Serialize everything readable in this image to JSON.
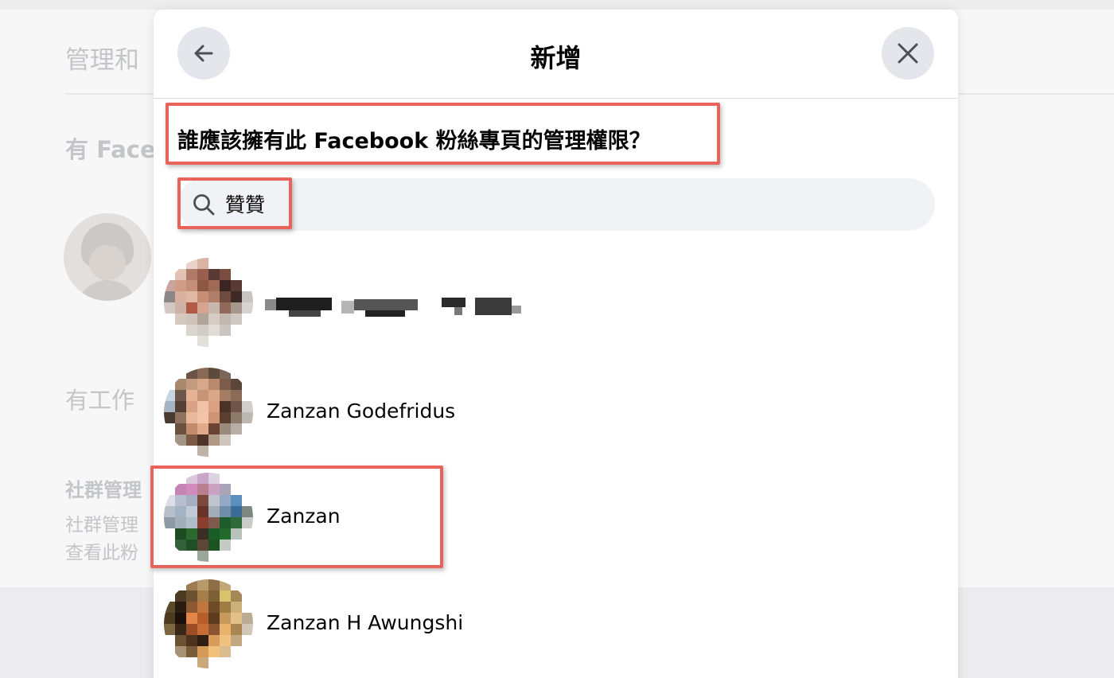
{
  "background": {
    "title": "管理和",
    "subtitle_1": "有 Face",
    "subtitle_2": "有工作",
    "subtitle_3": "社群管理",
    "line_1": "社群管理",
    "line_2": "查看此粉"
  },
  "dialog": {
    "title": "新增",
    "back_icon": "arrow-left-icon",
    "close_icon": "close-icon",
    "question": "誰應該擁有此 Facebook 粉絲專頁的管理權限？",
    "search": {
      "value": "贊贊",
      "icon": "search-icon"
    },
    "results": [
      {
        "name": "",
        "redacted": true
      },
      {
        "name": "Zanzan Godefridus"
      },
      {
        "name": "Zanzan"
      },
      {
        "name": "Zanzan H Awungshi"
      }
    ]
  },
  "colors": {
    "annotation": "#e8635a",
    "button_bg": "#e4e6eb",
    "search_bg": "#f0f2f5"
  }
}
